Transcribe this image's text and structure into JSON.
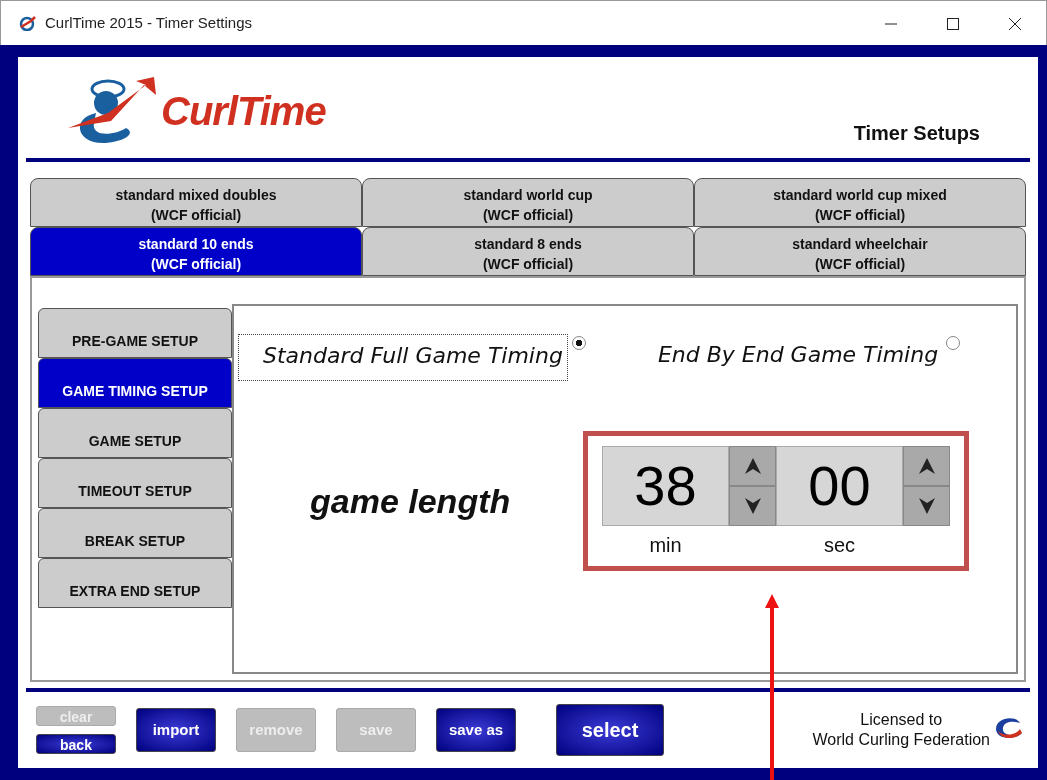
{
  "window": {
    "title": "CurlTime 2015 - Timer Settings"
  },
  "logo": {
    "text": "CurlTime"
  },
  "header": {
    "title": "Timer Setups"
  },
  "tab_rows": [
    [
      {
        "label": "standard mixed doubles",
        "sub": "(WCF official)",
        "selected": false
      },
      {
        "label": "standard world cup",
        "sub": "(WCF official)",
        "selected": false
      },
      {
        "label": "standard world cup mixed",
        "sub": "(WCF official)",
        "selected": false
      }
    ],
    [
      {
        "label": "standard 10 ends",
        "sub": "(WCF official)",
        "selected": true
      },
      {
        "label": "standard 8 ends",
        "sub": "(WCF official)",
        "selected": false
      },
      {
        "label": "standard wheelchair",
        "sub": "(WCF official)",
        "selected": false
      }
    ]
  ],
  "side_menu": [
    {
      "label": "PRE-GAME SETUP",
      "selected": false
    },
    {
      "label": "GAME TIMING SETUP",
      "selected": true
    },
    {
      "label": "GAME SETUP",
      "selected": false
    },
    {
      "label": "TIMEOUT SETUP",
      "selected": false
    },
    {
      "label": "BREAK SETUP",
      "selected": false
    },
    {
      "label": "EXTRA END SETUP",
      "selected": false
    }
  ],
  "timing_options": [
    {
      "label": "Standard Full Game Timing",
      "selected": true
    },
    {
      "label": "End By End Game Timing",
      "selected": false
    }
  ],
  "game_length": {
    "label": "game length",
    "fields": [
      {
        "value": "38",
        "unit": "min"
      },
      {
        "value": "00",
        "unit": "sec"
      }
    ]
  },
  "footer": {
    "small_buttons": [
      {
        "label": "clear",
        "disabled": true
      },
      {
        "label": "back",
        "disabled": false
      }
    ],
    "buttons": [
      {
        "label": "import",
        "disabled": false
      },
      {
        "label": "remove",
        "disabled": true
      },
      {
        "label": "save",
        "disabled": true
      },
      {
        "label": "save as",
        "disabled": false
      }
    ],
    "select": {
      "label": "select",
      "disabled": false
    },
    "license": [
      "Licensed to",
      "World Curling Federation"
    ]
  }
}
